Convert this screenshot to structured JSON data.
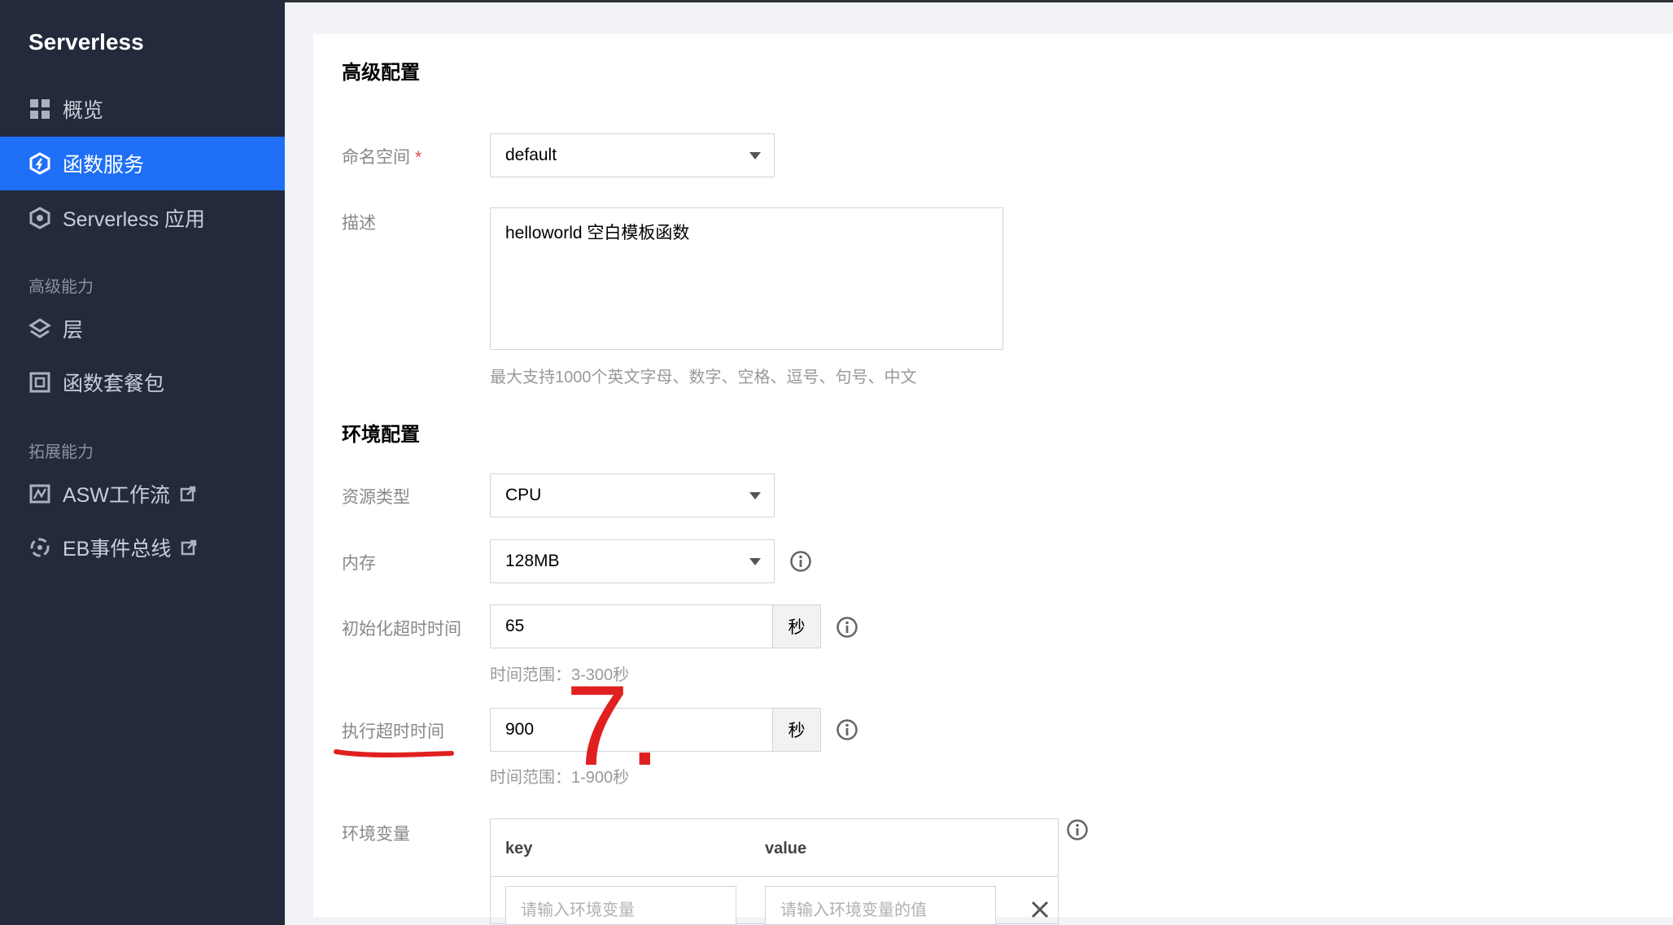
{
  "sidebar": {
    "brand": "Serverless",
    "items": [
      {
        "label": "概览",
        "icon": "grid-icon",
        "active": false
      },
      {
        "label": "函数服务",
        "icon": "function-icon",
        "active": true
      },
      {
        "label": "Serverless 应用",
        "icon": "app-icon",
        "active": false
      }
    ],
    "group_advanced": "高级能力",
    "advanced_items": [
      {
        "label": "层",
        "icon": "layers-icon"
      },
      {
        "label": "函数套餐包",
        "icon": "package-icon"
      }
    ],
    "group_extend": "拓展能力",
    "extend_items": [
      {
        "label": "ASW工作流",
        "icon": "workflow-icon",
        "external": true
      },
      {
        "label": "EB事件总线",
        "icon": "event-bus-icon",
        "external": true
      }
    ]
  },
  "advanced": {
    "title": "高级配置",
    "namespace_label": "命名空间",
    "namespace_required": "*",
    "namespace_value": "default",
    "description_label": "描述",
    "description_value": "helloworld 空白模板函数",
    "description_hint": "最大支持1000个英文字母、数字、空格、逗号、句号、中文"
  },
  "environment": {
    "title": "环境配置",
    "resource_type_label": "资源类型",
    "resource_type_value": "CPU",
    "memory_label": "内存",
    "memory_value": "128MB",
    "init_timeout_label": "初始化超时时间",
    "init_timeout_value": "65",
    "init_timeout_unit": "秒",
    "init_timeout_hint": "时间范围：3-300秒",
    "exec_timeout_label": "执行超时时间",
    "exec_timeout_value": "900",
    "exec_timeout_unit": "秒",
    "exec_timeout_hint": "时间范围：1-900秒",
    "env_vars_label": "环境变量",
    "env_key_header": "key",
    "env_value_header": "value",
    "env_key_placeholder": "请输入环境变量",
    "env_value_placeholder": "请输入环境变量的值"
  },
  "annotation": {
    "text": "7.",
    "color": "#e02020"
  }
}
